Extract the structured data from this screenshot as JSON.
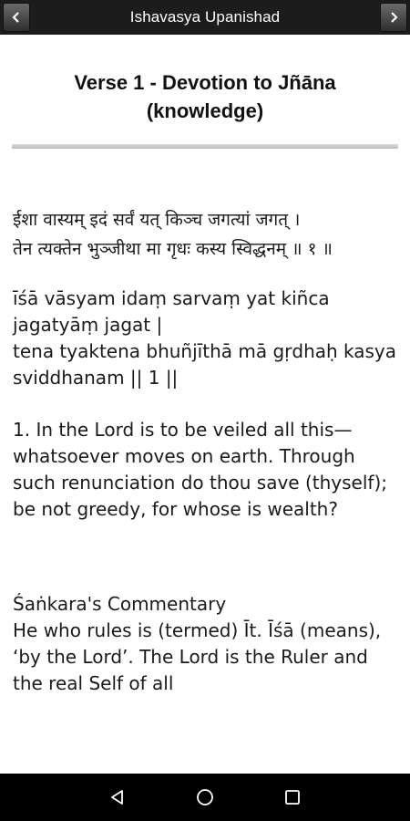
{
  "app_bar": {
    "title": "Ishavasya Upanishad",
    "prev_label": "<",
    "next_label": ">"
  },
  "verse": {
    "title": "Verse 1 - Devotion to Jñāna (knowledge)",
    "sanskrit": "ईशा वास्यम् इदं सर्वं यत् किञ्च जगत्यां जगत् ।\nतेन त्यक्तेन भुञ्जीथा मा गृधः कस्य स्विद्धनम् ॥ १ ॥",
    "transliteration": "īśā vāsyam idaṃ sarvaṃ yat kiñca jagatyāṃ jagat |\ntena tyaktena bhuñjīthā mā gṛdhaḥ kasya sviddhanam || 1 ||",
    "translation": "1. In the Lord is to be veiled all this—whatsoever moves on earth. Through such renunciation do thou save (thyself); be not greedy, for whose is wealth?",
    "commentary": "Śaṅkara's Commentary\nHe who rules is (termed) Īt. Īśā (means), ‘by the Lord’. The Lord is the Ruler and the real Self of all"
  },
  "system_nav": {
    "back": "back-icon",
    "home": "home-icon",
    "recents": "recents-icon"
  },
  "colors": {
    "app_bar": "#1c1c1c",
    "background": "#ffffff",
    "text": "#1a1a1a",
    "divider": "#c8c8c8",
    "nav_bar": "#000000"
  }
}
